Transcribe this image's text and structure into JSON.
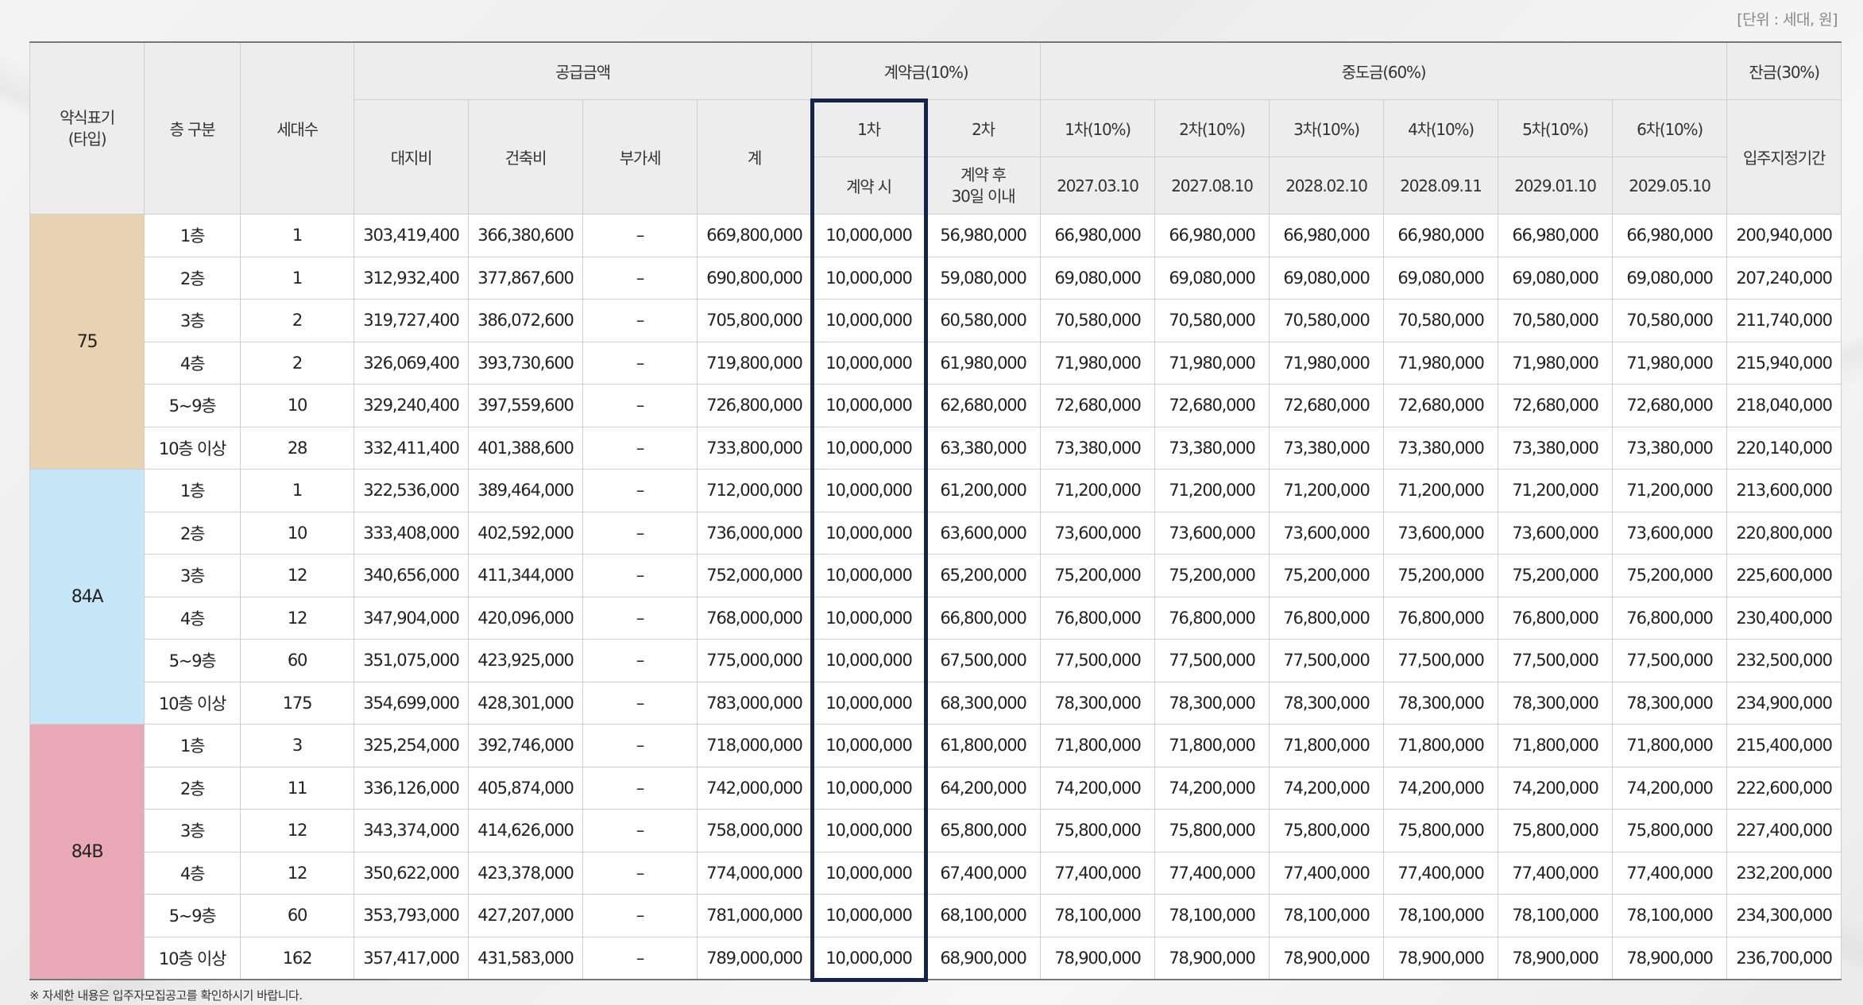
{
  "unit_label": "[단위 : 세대, 원]",
  "headers": {
    "type": "약식표기",
    "type_sub": "(타입)",
    "floor": "층 구분",
    "households": "세대수",
    "supply": "공급금액",
    "land": "대지비",
    "building": "건축비",
    "vat": "부가세",
    "total": "계",
    "deposit": "계약금(10%)",
    "dep1": "1차",
    "dep2": "2차",
    "dep1_when": "계약 시",
    "dep2_when": "계약 후 30일 이내",
    "mid": "중도금(60%)",
    "mid_labels": [
      "1차(10%)",
      "2차(10%)",
      "3차(10%)",
      "4차(10%)",
      "5차(10%)",
      "6차(10%)"
    ],
    "mid_dates": [
      "2027.03.10",
      "2027.08.10",
      "2028.02.10",
      "2028.09.11",
      "2029.01.10",
      "2029.05.10"
    ],
    "balance": "잔금(30%)",
    "balance_when": "입주지정기간"
  },
  "groups": [
    {
      "type": "75",
      "color": "#e8d2b1",
      "rows": [
        {
          "floor": "1층",
          "households": "1",
          "land": "303,419,400",
          "building": "366,380,600",
          "vat": "–",
          "total": "669,800,000",
          "dep1": "10,000,000",
          "dep2": "56,980,000",
          "mid": "66,980,000",
          "balance": "200,940,000"
        },
        {
          "floor": "2층",
          "households": "1",
          "land": "312,932,400",
          "building": "377,867,600",
          "vat": "–",
          "total": "690,800,000",
          "dep1": "10,000,000",
          "dep2": "59,080,000",
          "mid": "69,080,000",
          "balance": "207,240,000"
        },
        {
          "floor": "3층",
          "households": "2",
          "land": "319,727,400",
          "building": "386,072,600",
          "vat": "–",
          "total": "705,800,000",
          "dep1": "10,000,000",
          "dep2": "60,580,000",
          "mid": "70,580,000",
          "balance": "211,740,000"
        },
        {
          "floor": "4층",
          "households": "2",
          "land": "326,069,400",
          "building": "393,730,600",
          "vat": "–",
          "total": "719,800,000",
          "dep1": "10,000,000",
          "dep2": "61,980,000",
          "mid": "71,980,000",
          "balance": "215,940,000"
        },
        {
          "floor": "5~9층",
          "households": "10",
          "land": "329,240,400",
          "building": "397,559,600",
          "vat": "–",
          "total": "726,800,000",
          "dep1": "10,000,000",
          "dep2": "62,680,000",
          "mid": "72,680,000",
          "balance": "218,040,000"
        },
        {
          "floor": "10층 이상",
          "households": "28",
          "land": "332,411,400",
          "building": "401,388,600",
          "vat": "–",
          "total": "733,800,000",
          "dep1": "10,000,000",
          "dep2": "63,380,000",
          "mid": "73,380,000",
          "balance": "220,140,000"
        }
      ]
    },
    {
      "type": "84A",
      "color": "#c6e7f7",
      "rows": [
        {
          "floor": "1층",
          "households": "1",
          "land": "322,536,000",
          "building": "389,464,000",
          "vat": "–",
          "total": "712,000,000",
          "dep1": "10,000,000",
          "dep2": "61,200,000",
          "mid": "71,200,000",
          "balance": "213,600,000"
        },
        {
          "floor": "2층",
          "households": "10",
          "land": "333,408,000",
          "building": "402,592,000",
          "vat": "–",
          "total": "736,000,000",
          "dep1": "10,000,000",
          "dep2": "63,600,000",
          "mid": "73,600,000",
          "balance": "220,800,000"
        },
        {
          "floor": "3층",
          "households": "12",
          "land": "340,656,000",
          "building": "411,344,000",
          "vat": "–",
          "total": "752,000,000",
          "dep1": "10,000,000",
          "dep2": "65,200,000",
          "mid": "75,200,000",
          "balance": "225,600,000"
        },
        {
          "floor": "4층",
          "households": "12",
          "land": "347,904,000",
          "building": "420,096,000",
          "vat": "–",
          "total": "768,000,000",
          "dep1": "10,000,000",
          "dep2": "66,800,000",
          "mid": "76,800,000",
          "balance": "230,400,000"
        },
        {
          "floor": "5~9층",
          "households": "60",
          "land": "351,075,000",
          "building": "423,925,000",
          "vat": "–",
          "total": "775,000,000",
          "dep1": "10,000,000",
          "dep2": "67,500,000",
          "mid": "77,500,000",
          "balance": "232,500,000"
        },
        {
          "floor": "10층 이상",
          "households": "175",
          "land": "354,699,000",
          "building": "428,301,000",
          "vat": "–",
          "total": "783,000,000",
          "dep1": "10,000,000",
          "dep2": "68,300,000",
          "mid": "78,300,000",
          "balance": "234,900,000"
        }
      ]
    },
    {
      "type": "84B",
      "color": "#e8a8b6",
      "rows": [
        {
          "floor": "1층",
          "households": "3",
          "land": "325,254,000",
          "building": "392,746,000",
          "vat": "–",
          "total": "718,000,000",
          "dep1": "10,000,000",
          "dep2": "61,800,000",
          "mid": "71,800,000",
          "balance": "215,400,000"
        },
        {
          "floor": "2층",
          "households": "11",
          "land": "336,126,000",
          "building": "405,874,000",
          "vat": "–",
          "total": "742,000,000",
          "dep1": "10,000,000",
          "dep2": "64,200,000",
          "mid": "74,200,000",
          "balance": "222,600,000"
        },
        {
          "floor": "3층",
          "households": "12",
          "land": "343,374,000",
          "building": "414,626,000",
          "vat": "–",
          "total": "758,000,000",
          "dep1": "10,000,000",
          "dep2": "65,800,000",
          "mid": "75,800,000",
          "balance": "227,400,000"
        },
        {
          "floor": "4층",
          "households": "12",
          "land": "350,622,000",
          "building": "423,378,000",
          "vat": "–",
          "total": "774,000,000",
          "dep1": "10,000,000",
          "dep2": "67,400,000",
          "mid": "77,400,000",
          "balance": "232,200,000"
        },
        {
          "floor": "5~9층",
          "households": "60",
          "land": "353,793,000",
          "building": "427,207,000",
          "vat": "–",
          "total": "781,000,000",
          "dep1": "10,000,000",
          "dep2": "68,100,000",
          "mid": "78,100,000",
          "balance": "234,300,000"
        },
        {
          "floor": "10층 이상",
          "households": "162",
          "land": "357,417,000",
          "building": "431,583,000",
          "vat": "–",
          "total": "789,000,000",
          "dep1": "10,000,000",
          "dep2": "68,900,000",
          "mid": "78,900,000",
          "balance": "236,700,000"
        }
      ]
    }
  ],
  "highlight_color": "#13244a",
  "footnote": "※ 자세한 내용은 입주자모집공고를 확인하시기 바랍니다."
}
